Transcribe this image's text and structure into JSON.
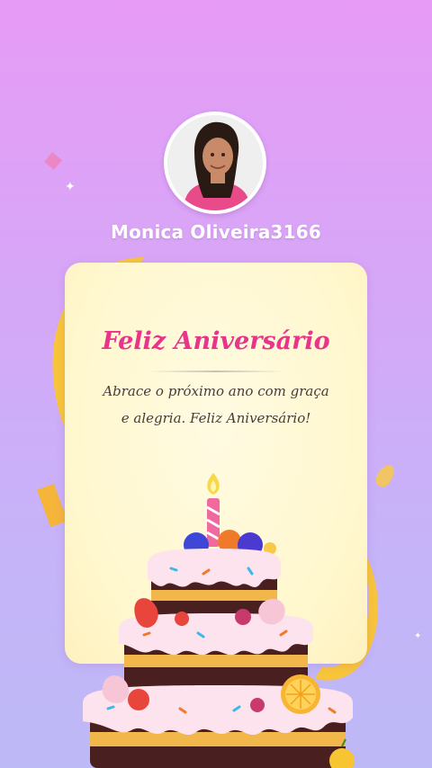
{
  "profile": {
    "username": "Monica Oliveira3166",
    "avatar_alt": "profile photo"
  },
  "card": {
    "title": "Feliz Aniversário",
    "message": "Abrace o próximo ano com graça e alegria. Feliz Aniversário!"
  },
  "colors": {
    "title": "#e8358a",
    "background_top": "#e79bf6",
    "background_bottom": "#bdb9f6",
    "card": "#fff7cd",
    "ribbon": "#f8c53a"
  },
  "icons": [
    "sparkle-icon",
    "confetti-icon",
    "birthday-cake-icon",
    "candle-icon"
  ]
}
